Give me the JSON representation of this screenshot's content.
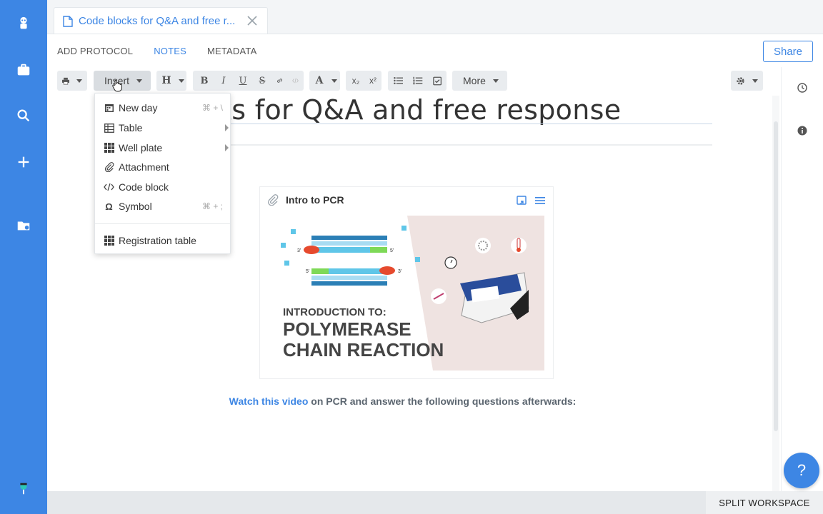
{
  "tab": {
    "title": "Code blocks for Q&A and free r..."
  },
  "subnav": [
    "ADD PROTOCOL",
    "NOTES",
    "METADATA"
  ],
  "subnav_active": "NOTES",
  "share_label": "Share",
  "toolbar": {
    "insert_label": "Insert",
    "heading_label": "H",
    "bold": "B",
    "italic": "I",
    "underline": "U",
    "strike": "S",
    "font_label": "A",
    "subscript": "x₂",
    "superscript": "x²",
    "more_label": "More"
  },
  "document": {
    "title_visible": "ks for Q&A and free response",
    "attachment_title": "Intro to PCR",
    "video_link": "Watch this video",
    "caption_rest": " on PCR and answer the following questions afterwards:"
  },
  "image_text": {
    "line1": "INTRODUCTION TO:",
    "line2": "POLYMERASE",
    "line3": "CHAIN REACTION",
    "strand_labels": [
      "3'",
      "5'",
      "5'",
      "3'"
    ]
  },
  "insert_menu": [
    {
      "label": "New day",
      "icon": "calendar-icon",
      "shortcut": "⌘ + \\",
      "submenu": false
    },
    {
      "label": "Table",
      "icon": "table-icon",
      "shortcut": "",
      "submenu": true
    },
    {
      "label": "Well plate",
      "icon": "well-plate-icon",
      "shortcut": "",
      "submenu": true
    },
    {
      "label": "Attachment",
      "icon": "paperclip-icon",
      "shortcut": "",
      "submenu": false
    },
    {
      "label": "Code block",
      "icon": "code-icon",
      "shortcut": "",
      "submenu": false
    },
    {
      "label": "Symbol",
      "icon": "omega-icon",
      "shortcut": "⌘ + ;",
      "submenu": false
    },
    {
      "label": "Registration table",
      "icon": "grid-icon",
      "shortcut": "",
      "submenu": false
    }
  ],
  "bottom": {
    "split_label": "SPLIT WORKSPACE",
    "help_label": "?"
  },
  "colors": {
    "accent": "#3d86e4",
    "sidebar": "#3d86e4"
  }
}
